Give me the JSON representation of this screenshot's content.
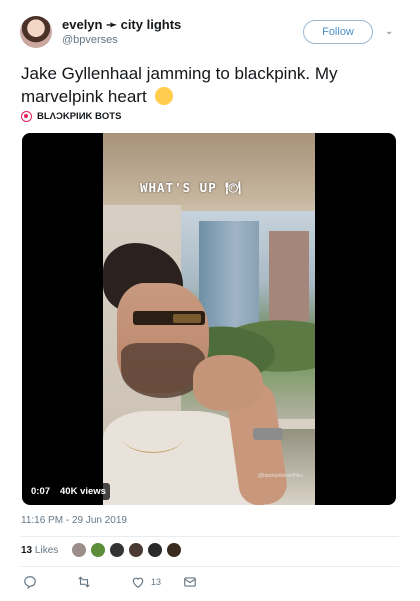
{
  "header": {
    "display_name": "evelyn ➛ city lights",
    "handle": "@bpverses",
    "follow_label": "Follow",
    "caret": "⌄"
  },
  "tweet": {
    "text": "Jake Gyllenhaal jamming to blackpink. My marvelpink heart",
    "emojis": [
      "pensive-face",
      "raised-hand-light-skin"
    ]
  },
  "attribution": {
    "label": "BLΛƆKPIИK BOTS"
  },
  "video": {
    "overlay_caption": "WHAT'S UP 🍽",
    "watermark": "@blackpinkinvidfiles",
    "duration": "0:07",
    "views": "40K views"
  },
  "meta": {
    "timestamp": "11:16 PM - 29 Jun 2019"
  },
  "stats": {
    "likes_count": "13",
    "likes_label": "Likes",
    "liker_colors": [
      "#9b8e8a",
      "#5b8d3a",
      "#333333",
      "#4a3a32",
      "#2a2a2a",
      "#3a2a20"
    ]
  },
  "actions": {
    "reply_icon": "reply-icon",
    "retweet_icon": "retweet-icon",
    "like_icon": "heart-icon",
    "like_count": "13",
    "dm_icon": "envelope-icon"
  },
  "colors": {
    "accent": "#1da1f2",
    "muted": "#657786",
    "text": "#14171a",
    "divider": "#e6ecf0"
  }
}
